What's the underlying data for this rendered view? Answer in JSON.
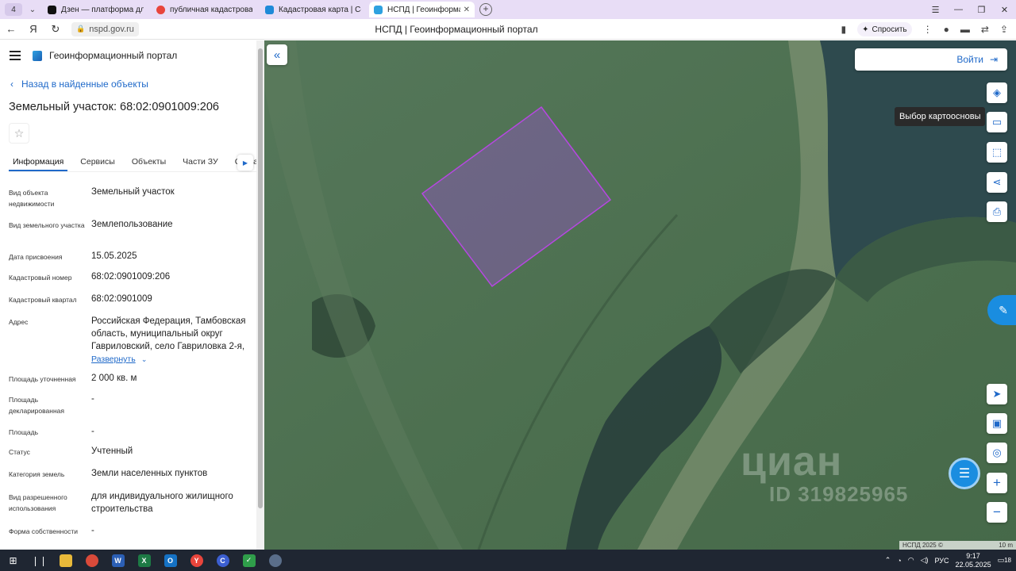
{
  "browser": {
    "tab_count": "4",
    "tabs": [
      {
        "label": "Дзен — платформа для п",
        "color": "#111111"
      },
      {
        "label": "публичная кадастровая к",
        "color": "#e8453c"
      },
      {
        "label": "Кадастровая карта | Серв",
        "color": "#1f8ad8"
      },
      {
        "label": "НСПД | Геоинформацио",
        "color": "#2ea1e0"
      }
    ],
    "url": "nspd.gov.ru",
    "page_title": "НСПД | Геоинформационный портал",
    "ask_label": "Спросить"
  },
  "panel": {
    "brand": "Геоинформационный портал",
    "back_label": "Назад в найденные объекты",
    "object_title": "Земельный участок: 68:02:0901009:206",
    "tabs": [
      "Информация",
      "Сервисы",
      "Объекты",
      "Части ЗУ",
      "Состав"
    ],
    "fields": [
      {
        "label": "Вид объекта недвижимости",
        "value": "Земельный участок"
      },
      {
        "label": "Вид земельного участка",
        "value": "Землепользование"
      },
      {
        "label": "Дата присвоения",
        "value": "15.05.2025"
      },
      {
        "label": "Кадастровый номер",
        "value": "68:02:0901009:206"
      },
      {
        "label": "Кадастровый квартал",
        "value": "68:02:0901009"
      },
      {
        "label": "Адрес",
        "value": "Российская Федерация, Тамбовская область, муниципальный округ Гавриловский, село Гавриловка 2-я,"
      },
      {
        "label": "Площадь уточненная",
        "value": "2 000 кв. м"
      },
      {
        "label": "Площадь декларированная",
        "value": "-"
      },
      {
        "label": "Площадь",
        "value": "-"
      },
      {
        "label": "Статус",
        "value": "Учтенный"
      },
      {
        "label": "Категория земель",
        "value": "Земли населенных пунктов"
      },
      {
        "label": "Вид разрешенного использования",
        "value": "для индивидуального жилищного строительства"
      },
      {
        "label": "Форма собственности",
        "value": "-"
      }
    ],
    "expand_label": "Развернуть"
  },
  "map": {
    "login_label": "Войти",
    "tooltip": "Выбор картоосновы",
    "watermark_name": "циан",
    "watermark_id": "ID 319825965",
    "attribution": "НСПД 2025 ©",
    "scale_label": "10 m",
    "parcel_color": "#9b4fd1"
  },
  "taskbar": {
    "lang": "РУС",
    "time": "9:17",
    "date": "22.05.2025",
    "notif_count": "18"
  }
}
